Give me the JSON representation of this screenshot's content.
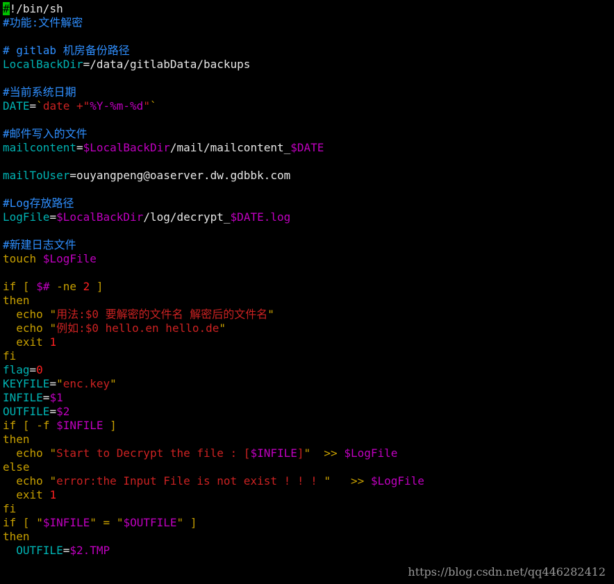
{
  "colors": {
    "text": "#e8e8e8",
    "comment": "#2f8fff",
    "variable": "#00b3b3",
    "string": "#cc2222",
    "special": "#c000c0",
    "keyword": "#c8a000",
    "number": "#ff2020",
    "cursor": "#00c000",
    "background": "#000000"
  },
  "cursor_char": "#",
  "lines": [
    [
      [
        "n",
        "!/bin/sh"
      ]
    ],
    [
      [
        "c",
        "#功能:文件解密"
      ]
    ],
    [],
    [
      [
        "c",
        "# gitlab 机房备份路径"
      ]
    ],
    [
      [
        "v",
        "LocalBackDir"
      ],
      [
        "n",
        "=/data/gitlabData/backups"
      ]
    ],
    [],
    [
      [
        "c",
        "#当前系统日期"
      ]
    ],
    [
      [
        "v",
        "DATE"
      ],
      [
        "n",
        "="
      ],
      [
        "k",
        "`"
      ],
      [
        "s",
        "date +\""
      ],
      [
        "m",
        "%Y-%m-%d"
      ],
      [
        "s",
        "\""
      ],
      [
        "k",
        "`"
      ]
    ],
    [],
    [
      [
        "c",
        "#邮件写入的文件"
      ]
    ],
    [
      [
        "v",
        "mailcontent"
      ],
      [
        "n",
        "="
      ],
      [
        "m",
        "$LocalBackDir"
      ],
      [
        "n",
        "/mail/mailcontent_"
      ],
      [
        "m",
        "$DATE"
      ]
    ],
    [],
    [
      [
        "v",
        "mailToUser"
      ],
      [
        "n",
        "=ouyangpeng@oaserver.dw.gdbbk.com"
      ]
    ],
    [],
    [
      [
        "c",
        "#Log存放路径"
      ]
    ],
    [
      [
        "v",
        "LogFile"
      ],
      [
        "n",
        "="
      ],
      [
        "m",
        "$LocalBackDir"
      ],
      [
        "n",
        "/log/decrypt_"
      ],
      [
        "m",
        "$DATE.log"
      ]
    ],
    [],
    [
      [
        "c",
        "#新建日志文件"
      ]
    ],
    [
      [
        "k",
        "touch "
      ],
      [
        "m",
        "$LogFile"
      ]
    ],
    [],
    [
      [
        "k",
        "if"
      ],
      [
        "n",
        " "
      ],
      [
        "k",
        "["
      ],
      [
        "n",
        " "
      ],
      [
        "m",
        "$#"
      ],
      [
        "n",
        " "
      ],
      [
        "k",
        "-ne"
      ],
      [
        "n",
        " "
      ],
      [
        "d",
        "2"
      ],
      [
        "n",
        " "
      ],
      [
        "k",
        "]"
      ]
    ],
    [
      [
        "k",
        "then"
      ]
    ],
    [
      [
        "n",
        "  "
      ],
      [
        "k",
        "echo"
      ],
      [
        "n",
        " "
      ],
      [
        "k",
        "\""
      ],
      [
        "s",
        "用法:$0 要解密的文件名 解密后的文件名"
      ],
      [
        "k",
        "\""
      ]
    ],
    [
      [
        "n",
        "  "
      ],
      [
        "k",
        "echo"
      ],
      [
        "n",
        " "
      ],
      [
        "k",
        "\""
      ],
      [
        "s",
        "例如:$0 hello.en hello.de"
      ],
      [
        "k",
        "\""
      ]
    ],
    [
      [
        "n",
        "  "
      ],
      [
        "k",
        "exit"
      ],
      [
        "n",
        " "
      ],
      [
        "d",
        "1"
      ]
    ],
    [
      [
        "k",
        "fi"
      ]
    ],
    [
      [
        "v",
        "flag"
      ],
      [
        "n",
        "="
      ],
      [
        "d",
        "0"
      ]
    ],
    [
      [
        "v",
        "KEYFILE"
      ],
      [
        "n",
        "="
      ],
      [
        "k",
        "\""
      ],
      [
        "s",
        "enc.key"
      ],
      [
        "k",
        "\""
      ]
    ],
    [
      [
        "v",
        "INFILE"
      ],
      [
        "n",
        "="
      ],
      [
        "m",
        "$1"
      ]
    ],
    [
      [
        "v",
        "OUTFILE"
      ],
      [
        "n",
        "="
      ],
      [
        "m",
        "$2"
      ]
    ],
    [
      [
        "k",
        "if"
      ],
      [
        "n",
        " "
      ],
      [
        "k",
        "["
      ],
      [
        "n",
        " "
      ],
      [
        "k",
        "-f"
      ],
      [
        "n",
        " "
      ],
      [
        "m",
        "$INFILE"
      ],
      [
        "n",
        " "
      ],
      [
        "k",
        "]"
      ]
    ],
    [
      [
        "k",
        "then"
      ]
    ],
    [
      [
        "n",
        "  "
      ],
      [
        "k",
        "echo"
      ],
      [
        "n",
        " "
      ],
      [
        "k",
        "\""
      ],
      [
        "s",
        "Start to Decrypt the file : ["
      ],
      [
        "m",
        "$INFILE"
      ],
      [
        "s",
        "]"
      ],
      [
        "k",
        "\""
      ],
      [
        "n",
        "  "
      ],
      [
        "k",
        ">>"
      ],
      [
        "n",
        " "
      ],
      [
        "m",
        "$LogFile"
      ]
    ],
    [
      [
        "k",
        "else"
      ]
    ],
    [
      [
        "n",
        "  "
      ],
      [
        "k",
        "echo"
      ],
      [
        "n",
        " "
      ],
      [
        "k",
        "\""
      ],
      [
        "s",
        "error:the Input File is not exist ! ! ! "
      ],
      [
        "k",
        "\""
      ],
      [
        "n",
        "   "
      ],
      [
        "k",
        ">>"
      ],
      [
        "n",
        " "
      ],
      [
        "m",
        "$LogFile"
      ]
    ],
    [
      [
        "n",
        "  "
      ],
      [
        "k",
        "exit"
      ],
      [
        "n",
        " "
      ],
      [
        "d",
        "1"
      ]
    ],
    [
      [
        "k",
        "fi"
      ]
    ],
    [
      [
        "k",
        "if"
      ],
      [
        "n",
        " "
      ],
      [
        "k",
        "["
      ],
      [
        "n",
        " "
      ],
      [
        "k",
        "\""
      ],
      [
        "m",
        "$INFILE"
      ],
      [
        "k",
        "\""
      ],
      [
        "n",
        " "
      ],
      [
        "k",
        "="
      ],
      [
        "n",
        " "
      ],
      [
        "k",
        "\""
      ],
      [
        "m",
        "$OUTFILE"
      ],
      [
        "k",
        "\""
      ],
      [
        "n",
        " "
      ],
      [
        "k",
        "]"
      ]
    ],
    [
      [
        "k",
        "then"
      ]
    ],
    [
      [
        "n",
        "  "
      ],
      [
        "v",
        "OUTFILE"
      ],
      [
        "n",
        "="
      ],
      [
        "m",
        "$2.TMP"
      ]
    ]
  ],
  "watermark": "https://blog.csdn.net/qq446282412"
}
